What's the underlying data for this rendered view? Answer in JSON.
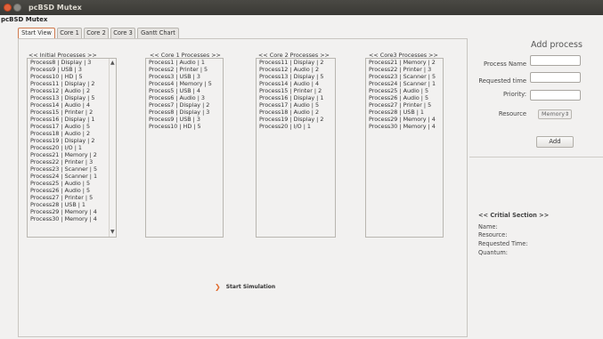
{
  "window": {
    "title": "pcBSD Mutex",
    "app_title": "pcBSD Mutex"
  },
  "tabs": [
    {
      "label": "Start View",
      "active": true
    },
    {
      "label": "Core 1",
      "active": false
    },
    {
      "label": "Core 2",
      "active": false
    },
    {
      "label": "Core 3",
      "active": false
    },
    {
      "label": "Gantt Chart",
      "active": false
    }
  ],
  "columns": {
    "initial": {
      "header": "<< Initial Processes >>",
      "items": [
        "Process8 | Display | 3",
        "Process9 | USB | 3",
        "Process10 | HD | 5",
        "Process11 | Display | 2",
        "Process12 | Audio | 2",
        "Process13 | Display | 5",
        "Process14 | Audio | 4",
        "Process15 | Printer | 2",
        "Process16 | Display | 1",
        "Process17 | Audio | 5",
        "Process18 | Audio | 2",
        "Process19 | Display | 2",
        "Process20 | I/O | 1",
        "Process21 | Memory | 2",
        "Process22 | Printer | 3",
        "Process23 | Scanner | 5",
        "Process24 | Scanner | 1",
        "Process25 | Audio | 5",
        "Process26 | Audio | 5",
        "Process27 | Printer | 5",
        "Process28 | USB | 1",
        "Process29 | Memory | 4",
        "Process30 | Memory | 4"
      ]
    },
    "core1": {
      "header": "<< Core 1 Processes >>",
      "items": [
        "Process1 | Audio | 1",
        "Process2 | Printer | 5",
        "Process3 | USB | 3",
        "Process4 | Memory | 5",
        "Process5 | USB | 4",
        "Process6 | Audio | 3",
        "Process7 | Display | 2",
        "Process8 | Display | 3",
        "Process9 | USB | 3",
        "Process10 | HD | 5"
      ]
    },
    "core2": {
      "header": "<< Core 2 Processes >>",
      "items": [
        "Process11 | Display | 2",
        "Process12 | Audio | 2",
        "Process13 | Display | 5",
        "Process14 | Audio | 4",
        "Process15 | Printer | 2",
        "Process16 | Display | 1",
        "Process17 | Audio | 5",
        "Process18 | Audio | 2",
        "Process19 | Display | 2",
        "Process20 | I/O | 1"
      ]
    },
    "core3": {
      "header": "<< Core3 Processes >>",
      "items": [
        "Process21 | Memory | 2",
        "Process22 | Printer | 3",
        "Process23 | Scanner | 5",
        "Process24 | Scanner | 1",
        "Process25 | Audio | 5",
        "Process26 | Audio | 5",
        "Process27 | Printer | 5",
        "Process28 | USB | 1",
        "Process29 | Memory | 4",
        "Process30 | Memory | 4"
      ]
    }
  },
  "start_simulation": {
    "label": "Start Simulation",
    "icon": "play-arrow-icon"
  },
  "add_process": {
    "title": "Add process",
    "process_name_label": "Process Name",
    "requested_time_label": "Requested time",
    "priority_label": "Priority:",
    "resource_label": "Resource",
    "resource_value": "Memory",
    "add_button": "Add"
  },
  "critical_section": {
    "title": "<< Critial Section >>",
    "name_label": "Name:",
    "resource_label": "Resource:",
    "requested_time_label": "Requested Time:",
    "quantum_label": "Quantum:"
  },
  "colors": {
    "titlebar": "#3c3b37",
    "close_button": "#e2613a",
    "accent": "#e06a2c",
    "background": "#f2f1f0"
  }
}
